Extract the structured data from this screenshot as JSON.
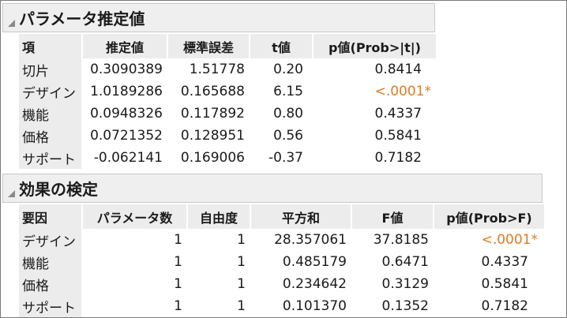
{
  "param_section": {
    "title": "パラメータ推定値",
    "columns": [
      "項",
      "推定値",
      "標準誤差",
      "t値",
      "p値(Prob>|t|)"
    ],
    "rows": [
      {
        "term": "切片",
        "estimate": "0.3090389",
        "std_error": "1.51778",
        "t_value": "0.20",
        "p_value": "0.8414"
      },
      {
        "term": "デザイン",
        "estimate": "1.0189286",
        "std_error": "0.165688",
        "t_value": "6.15",
        "p_value": "<.0001*"
      },
      {
        "term": "機能",
        "estimate": "0.0948326",
        "std_error": "0.117892",
        "t_value": "0.80",
        "p_value": "0.4337"
      },
      {
        "term": "価格",
        "estimate": "0.0721352",
        "std_error": "0.128951",
        "t_value": "0.56",
        "p_value": "0.5841"
      },
      {
        "term": "サポート",
        "estimate": "-0.062141",
        "std_error": "0.169006",
        "t_value": "-0.37",
        "p_value": "0.7182"
      }
    ]
  },
  "effect_section": {
    "title": "効果の検定",
    "columns": [
      "要因",
      "パラメータ数",
      "自由度",
      "平方和",
      "F値",
      "p値(Prob>F)"
    ],
    "rows": [
      {
        "source": "デザイン",
        "nparm": "1",
        "df": "1",
        "ss": "28.357061",
        "f_ratio": "37.8185",
        "p_value": "<.0001*"
      },
      {
        "source": "機能",
        "nparm": "1",
        "df": "1",
        "ss": "0.485179",
        "f_ratio": "0.6471",
        "p_value": "0.4337"
      },
      {
        "source": "価格",
        "nparm": "1",
        "df": "1",
        "ss": "0.234642",
        "f_ratio": "0.3129",
        "p_value": "0.5841"
      },
      {
        "source": "サポート",
        "nparm": "1",
        "df": "1",
        "ss": "0.101370",
        "f_ratio": "0.1352",
        "p_value": "0.7182"
      }
    ]
  },
  "colors": {
    "significant_p": "#e07b20",
    "header_bg": "#ececec",
    "section_bg": "#efefef"
  },
  "icons": {
    "disclosure": "disclosure-triangle-icon"
  }
}
